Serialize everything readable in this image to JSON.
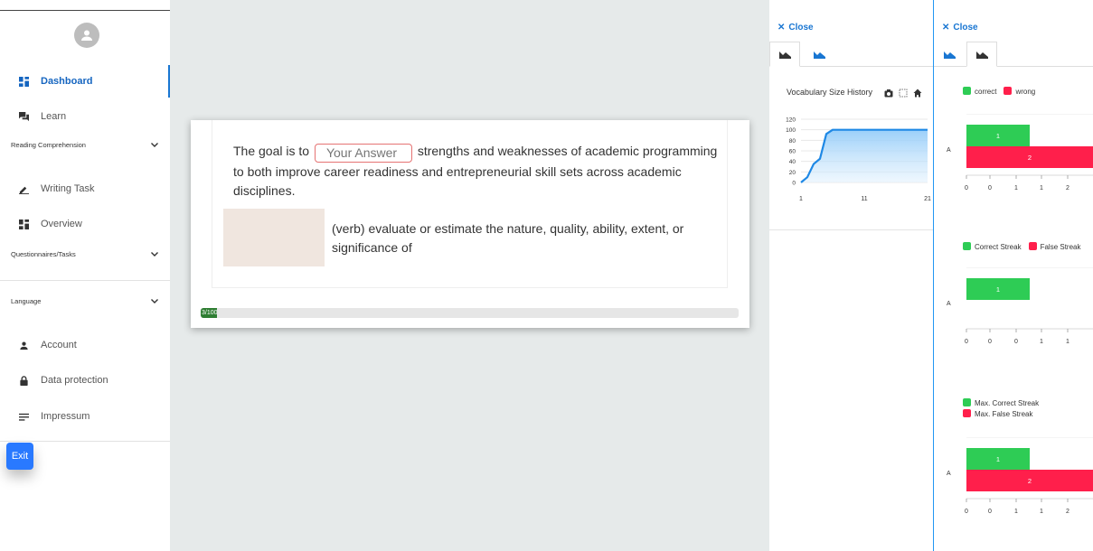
{
  "sidebar": {
    "items": [
      {
        "label": "Dashboard",
        "icon": "dashboard-icon",
        "active": true
      },
      {
        "label": "Learn",
        "icon": "chat-icon"
      },
      {
        "label": "Writing Task",
        "icon": "pencil-icon"
      },
      {
        "label": "Overview",
        "icon": "dashboard-icon"
      },
      {
        "label": "Account",
        "icon": "person-icon"
      },
      {
        "label": "Data protection",
        "icon": "lock-icon"
      },
      {
        "label": "Impressum",
        "icon": "notes-icon"
      }
    ],
    "sections": {
      "reading": "Reading Comprehension",
      "questionnaires": "Questionnaires/Tasks",
      "language": "Language"
    },
    "exit_label": "Exit"
  },
  "exercise": {
    "sentence_before": "The goal is to",
    "answer_placeholder": "Your Answer",
    "sentence_after": "strengths and weaknesses of academic programming to both improve career readiness and entrepreneurial skill sets across academic disciplines.",
    "definition": "(verb) evaluate or estimate the nature, quality, ability, extent, or significance of",
    "progress_label": "3/100",
    "progress_fraction": 0.03
  },
  "panels": {
    "close_label": "Close"
  },
  "colors": {
    "accent": "#1976d2",
    "correct": "#2ecc55",
    "wrong": "#ff1f4b",
    "line": "#1e88e5"
  },
  "chart_data": [
    {
      "type": "area",
      "title": "Vocabulary Size History",
      "x": [
        1,
        2,
        3,
        4,
        5,
        6,
        7,
        8,
        9,
        10,
        11,
        12,
        13,
        14,
        15,
        16,
        17,
        18,
        19,
        20,
        21
      ],
      "values": [
        0,
        10,
        35,
        45,
        92,
        100,
        100,
        100,
        100,
        100,
        100,
        100,
        100,
        100,
        100,
        100,
        100,
        100,
        100,
        100,
        100
      ],
      "xticks": [
        "1",
        "11",
        "21"
      ],
      "yticks": [
        "0",
        "20",
        "40",
        "60",
        "80",
        "100",
        "120"
      ],
      "ylim": [
        0,
        120
      ],
      "grid": true
    },
    {
      "type": "bar",
      "orientation": "horizontal",
      "categories": [
        "A"
      ],
      "legend": "top-left",
      "series": [
        {
          "name": "correct",
          "values": [
            1
          ]
        },
        {
          "name": "wrong",
          "values": [
            2
          ]
        }
      ],
      "xticks": [
        "0",
        "0",
        "1",
        "1",
        "2"
      ]
    },
    {
      "type": "bar",
      "orientation": "horizontal",
      "categories": [
        "A"
      ],
      "legend": "top-left",
      "series": [
        {
          "name": "Correct Streak",
          "values": [
            1
          ]
        },
        {
          "name": "False Streak",
          "values": [
            0
          ]
        }
      ],
      "xticks": [
        "0",
        "0",
        "0",
        "1",
        "1"
      ]
    },
    {
      "type": "bar",
      "orientation": "horizontal",
      "categories": [
        "A"
      ],
      "legend": "top-left",
      "series": [
        {
          "name": "Max. Correct Streak",
          "values": [
            1
          ]
        },
        {
          "name": "Max. False Streak",
          "values": [
            2
          ]
        }
      ],
      "xticks": [
        "0",
        "0",
        "1",
        "1",
        "2"
      ]
    }
  ]
}
